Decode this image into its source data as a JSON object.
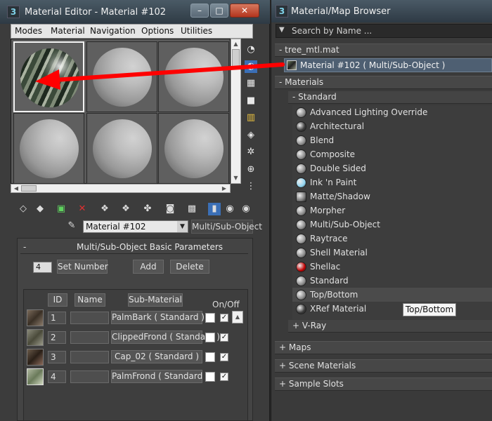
{
  "material_editor": {
    "title": "Material Editor - Material #102",
    "menus": [
      "Modes",
      "Material",
      "Navigation",
      "Options",
      "Utilities"
    ],
    "material_name": "Material #102",
    "material_type": "Multi/Sub-Object",
    "rollout_title": "Multi/Sub-Object Basic Parameters",
    "rollout_toggle": "-",
    "count": "4",
    "buttons": {
      "set_number": "Set Number",
      "add": "Add",
      "delete": "Delete"
    },
    "columns": {
      "id": "ID",
      "name": "Name",
      "sub_material": "Sub-Material",
      "on_off": "On/Off"
    },
    "rows": [
      {
        "id": "1",
        "sub_material": "PalmBark  ( Standard )"
      },
      {
        "id": "2",
        "sub_material": "ClippedFrond  ( Standard )"
      },
      {
        "id": "3",
        "sub_material": "Cap_02  ( Standard )"
      },
      {
        "id": "4",
        "sub_material": "PalmFrond  ( Standard )"
      }
    ],
    "window_buttons": {
      "minimize": "–",
      "maximize": "□",
      "close": "✕"
    }
  },
  "browser": {
    "title": "Material/Map Browser",
    "search_placeholder": "Search by Name ...",
    "scene_group": "- tree_mtl.mat",
    "selected_item": "Material #102  ( Multi/Sub-Object )",
    "materials_group": "- Materials",
    "standard_group": "- Standard",
    "materials": [
      {
        "label": "Advanced Lighting Override",
        "icon_color": "#8a8a8a"
      },
      {
        "label": "Architectural",
        "icon_color": "#3a3a3a"
      },
      {
        "label": "Blend",
        "icon_color": "#8a8a8a"
      },
      {
        "label": "Composite",
        "icon_color": "#8a8a8a"
      },
      {
        "label": "Double Sided",
        "icon_color": "#8a8a8a"
      },
      {
        "label": "Ink 'n Paint",
        "icon_color": "#8fd3ef"
      },
      {
        "label": "Matte/Shadow",
        "icon_color": "#7a7a7a"
      },
      {
        "label": "Morpher",
        "icon_color": "#8a8a8a"
      },
      {
        "label": "Multi/Sub-Object",
        "icon_color": "#8a8a8a"
      },
      {
        "label": "Raytrace",
        "icon_color": "#9a9a9a"
      },
      {
        "label": "Shell Material",
        "icon_color": "#8a8a8a"
      },
      {
        "label": "Shellac",
        "icon_color": "#c00000"
      },
      {
        "label": "Standard",
        "icon_color": "#8a8a8a"
      },
      {
        "label": "Top/Bottom",
        "icon_color": "#8a8a8a"
      },
      {
        "label": "XRef Material",
        "icon_color": "#3a3a3a"
      }
    ],
    "vray_group": "+ V-Ray",
    "maps_group": "+ Maps",
    "scene_materials_group": "+ Scene Materials",
    "sample_slots_group": "+ Sample Slots",
    "tooltip": "Top/Bottom"
  },
  "annotation_color": "#ff0000"
}
